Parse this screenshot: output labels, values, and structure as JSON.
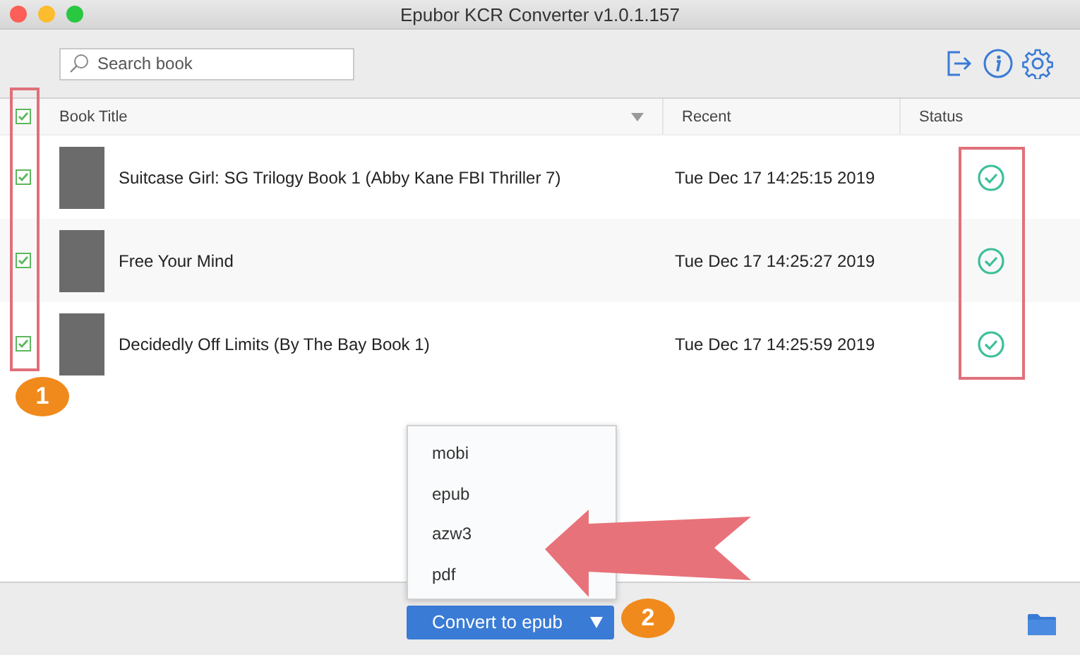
{
  "window": {
    "title": "Epubor KCR Converter v1.0.1.157"
  },
  "search": {
    "placeholder": "Search book"
  },
  "header": {
    "checked": true,
    "columns": [
      "Book Title",
      "Recent",
      "Status"
    ]
  },
  "rows": [
    {
      "checked": true,
      "title": "Suitcase Girl: SG Trilogy Book 1 (Abby Kane FBI Thriller 7)",
      "recent": "Tue Dec 17 14:25:15 2019",
      "completed": true
    },
    {
      "checked": true,
      "title": "Free Your Mind",
      "recent": "Tue Dec 17 14:25:27 2019",
      "completed": true
    },
    {
      "checked": true,
      "title": "Decidedly Off Limits (By The Bay Book 1)",
      "recent": "Tue Dec 17 14:25:59 2019",
      "completed": true
    }
  ],
  "format_menu": [
    "mobi",
    "epub",
    "azw3",
    "pdf"
  ],
  "convert_button": {
    "label": "Convert to epub"
  },
  "step_badges": [
    "1",
    "2"
  ]
}
